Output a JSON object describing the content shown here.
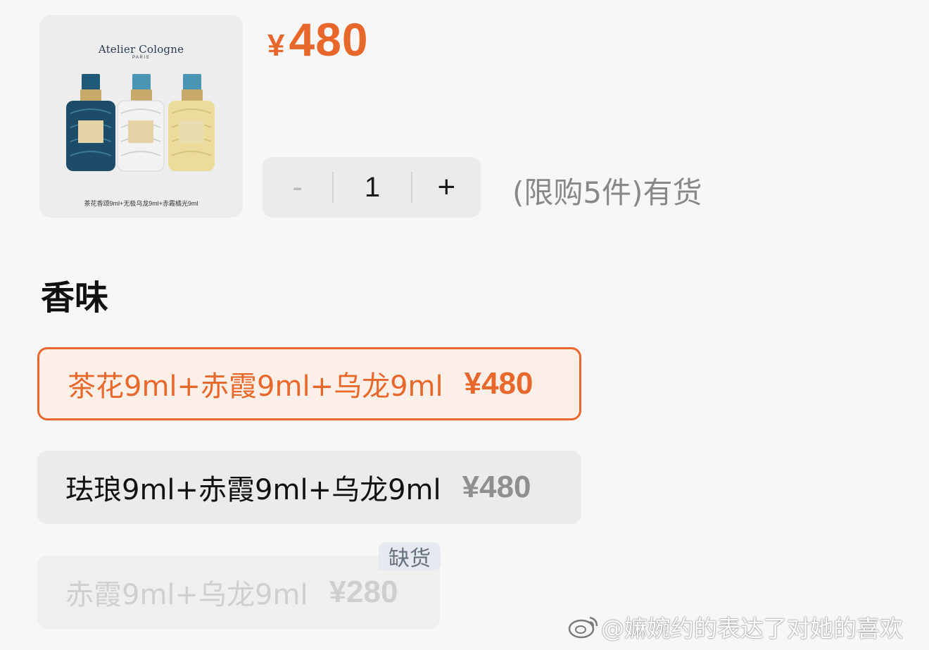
{
  "product": {
    "brand": "Atelier Cologne",
    "brand_sub": "PARIS",
    "caption": "茶花香颂9ml+无极乌龙9ml+赤霞橘光9ml"
  },
  "price": {
    "currency": "¥",
    "value": "480"
  },
  "quantity": {
    "minus_label": "-",
    "value": "1",
    "plus_label": "+",
    "stock_text": "(限购5件)有货"
  },
  "section_title": "香味",
  "options": [
    {
      "name": "茶花9ml+赤霞9ml+乌龙9ml",
      "price": "¥480",
      "state": "selected"
    },
    {
      "name": "珐琅9ml+赤霞9ml+乌龙9ml",
      "price": "¥480",
      "state": "available"
    },
    {
      "name": "赤霞9ml+乌龙9ml",
      "price": "¥280",
      "state": "sold-out",
      "badge": "缺货"
    }
  ],
  "watermark": "@嫲婉约的表达了对她的喜欢",
  "colors": {
    "accent": "#e8672a",
    "selected_bg": "#fbefe8",
    "option_bg": "#ebebeb",
    "page_bg": "#f7f7f7"
  }
}
